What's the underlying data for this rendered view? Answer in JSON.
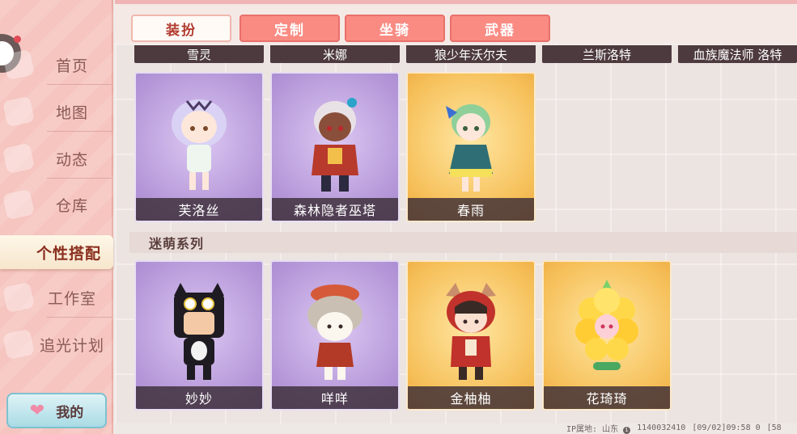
{
  "sidebar": {
    "items": [
      {
        "label": "首页"
      },
      {
        "label": "地图"
      },
      {
        "label": "动态"
      },
      {
        "label": "仓库"
      },
      {
        "label": "个性搭配"
      },
      {
        "label": "工作室"
      },
      {
        "label": "追光计划"
      }
    ],
    "active_index": 4,
    "mine_label": "我的",
    "mine_icon": "heart-icon"
  },
  "tabs": [
    {
      "label": "装扮",
      "active": true
    },
    {
      "label": "定制",
      "active": false
    },
    {
      "label": "坐骑",
      "active": false
    },
    {
      "label": "武器",
      "active": false
    }
  ],
  "top_row_names": [
    "雪灵",
    "米娜",
    "狼少年沃尔夫",
    "兰斯洛特",
    "血族魔法师 洛特"
  ],
  "row1_cards": [
    {
      "name": "芙洛丝",
      "bg": "purple"
    },
    {
      "name": "森林隐者巫塔",
      "bg": "purple"
    },
    {
      "name": "春雨",
      "bg": "gold"
    }
  ],
  "section_title": "迷萌系列",
  "row2_cards": [
    {
      "name": "妙妙",
      "bg": "purple"
    },
    {
      "name": "咩咩",
      "bg": "purple"
    },
    {
      "name": "金柚柚",
      "bg": "gold"
    },
    {
      "name": "花琦琦",
      "bg": "gold"
    }
  ],
  "status": {
    "ip_label": "IP属地: 山东",
    "uid": "1140032410",
    "time": "[09/02]09:58 0",
    "extra": "[58"
  },
  "colors": {
    "sidebar_bg": "#f6c5c0",
    "tab_inactive": "#f98b83",
    "tab_active_text": "#b23b2f",
    "card_purple": "#b698d9",
    "card_gold": "#f6c05a"
  }
}
